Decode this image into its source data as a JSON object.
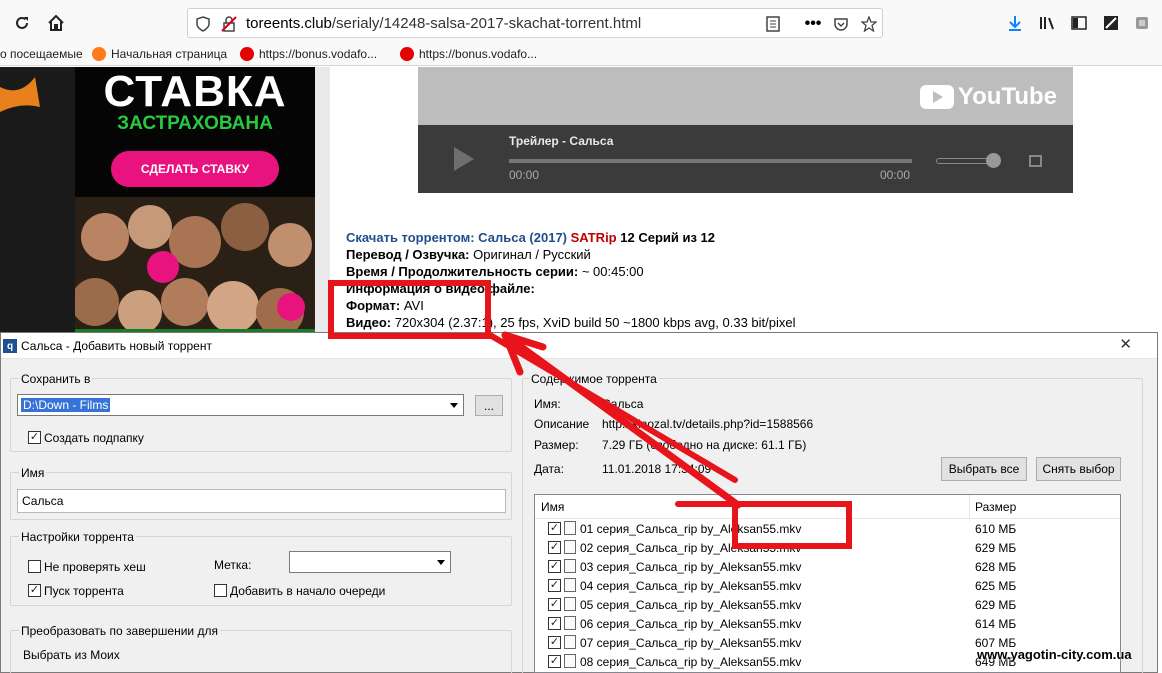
{
  "browser": {
    "url_host": "toreents.club",
    "url_path": "/serialy/14248-salsa-2017-skachat-torrent.html",
    "bookmarks": [
      "о посещаемые",
      "Начальная страница",
      "https://bonus.vodafo...",
      "https://bonus.vodafo..."
    ]
  },
  "ad": {
    "title": "СТАВКА",
    "subtitle": "ЗАСТРАХОВАНА",
    "button": "СДЕЛАТЬ СТАВКУ"
  },
  "video": {
    "brand": "YouTube",
    "title": "Трейлер - Сальса",
    "time_start": "00:00",
    "time_end": "00:00"
  },
  "description": {
    "line1_label": "Скачать торрентом: Сальса (2017)",
    "line1_quality": "SATRip",
    "line1_tail": "12 Серий из 12",
    "line2_label": "Перевод / Озвучка:",
    "line2_value": "Оригинал / Русский",
    "line3_label": "Время / Продолжительность серии:",
    "line3_value": "~ 00:45:00",
    "line4_label": "Информация о видео файле:",
    "line5_label": "Формат:",
    "line5_value": "AVI",
    "line6_label": "Видео:",
    "line6_value": "720x304 (2.37:1), 25 fps, XviD build 50 ~1800 kbps avg, 0.33 bit/pixel"
  },
  "dialog": {
    "title": "Сальса - Добавить новый торрент",
    "save_to_label": "Сохранить в",
    "save_path": "D:\\Down - Films",
    "browse_label": "...",
    "create_subfolder": "Создать подпапку",
    "name_label": "Имя",
    "name_value": "Сальса",
    "settings_label": "Настройки торрента",
    "skip_hash": "Не проверять хеш",
    "start_torrent": "Пуск торрента",
    "tag_label": "Метка:",
    "add_top": "Добавить в начало очереди",
    "convert_label": "Преобразовать по завершении для",
    "choose_label": "Выбрать из Моих",
    "content_label": "Содержимое торрента",
    "info": [
      {
        "key": "Имя:",
        "value": "Сальса"
      },
      {
        "key": "Описание",
        "value": "http://kinozal.tv/details.php?id=1588566"
      },
      {
        "key": "Размер:",
        "value": "7.29 ГБ (свободно на диске: 61.1 ГБ)"
      },
      {
        "key": "Дата:",
        "value": "11.01.2018 17:34:09"
      }
    ],
    "select_all": "Выбрать все",
    "deselect": "Снять выбор",
    "col_name": "Имя",
    "col_size": "Размер",
    "files": [
      {
        "name": "01 серия_Сальса_rip by_Aleksan55.mkv",
        "size": "610 МБ"
      },
      {
        "name": "02 серия_Сальса_rip by_Aleksan55.mkv",
        "size": "629 МБ"
      },
      {
        "name": "03 серия_Сальса_rip by_Aleksan55.mkv",
        "size": "628 МБ"
      },
      {
        "name": "04 серия_Сальса_rip by_Aleksan55.mkv",
        "size": "625 МБ"
      },
      {
        "name": "05 серия_Сальса_rip by_Aleksan55.mkv",
        "size": "629 МБ"
      },
      {
        "name": "06 серия_Сальса_rip by_Aleksan55.mkv",
        "size": "614 МБ"
      },
      {
        "name": "07 серия_Сальса_rip by_Aleksan55.mkv",
        "size": "607 МБ"
      },
      {
        "name": "08 серия_Сальса_rip by_Aleksan55.mkv",
        "size": "649 МБ"
      }
    ]
  },
  "watermark": "www.yagotin-city.com.ua",
  "colors": {
    "accent_red": "#e8141c",
    "title_blue": "#1f4e8c",
    "ad_pink": "#e8137e",
    "ad_green": "#28c840"
  }
}
